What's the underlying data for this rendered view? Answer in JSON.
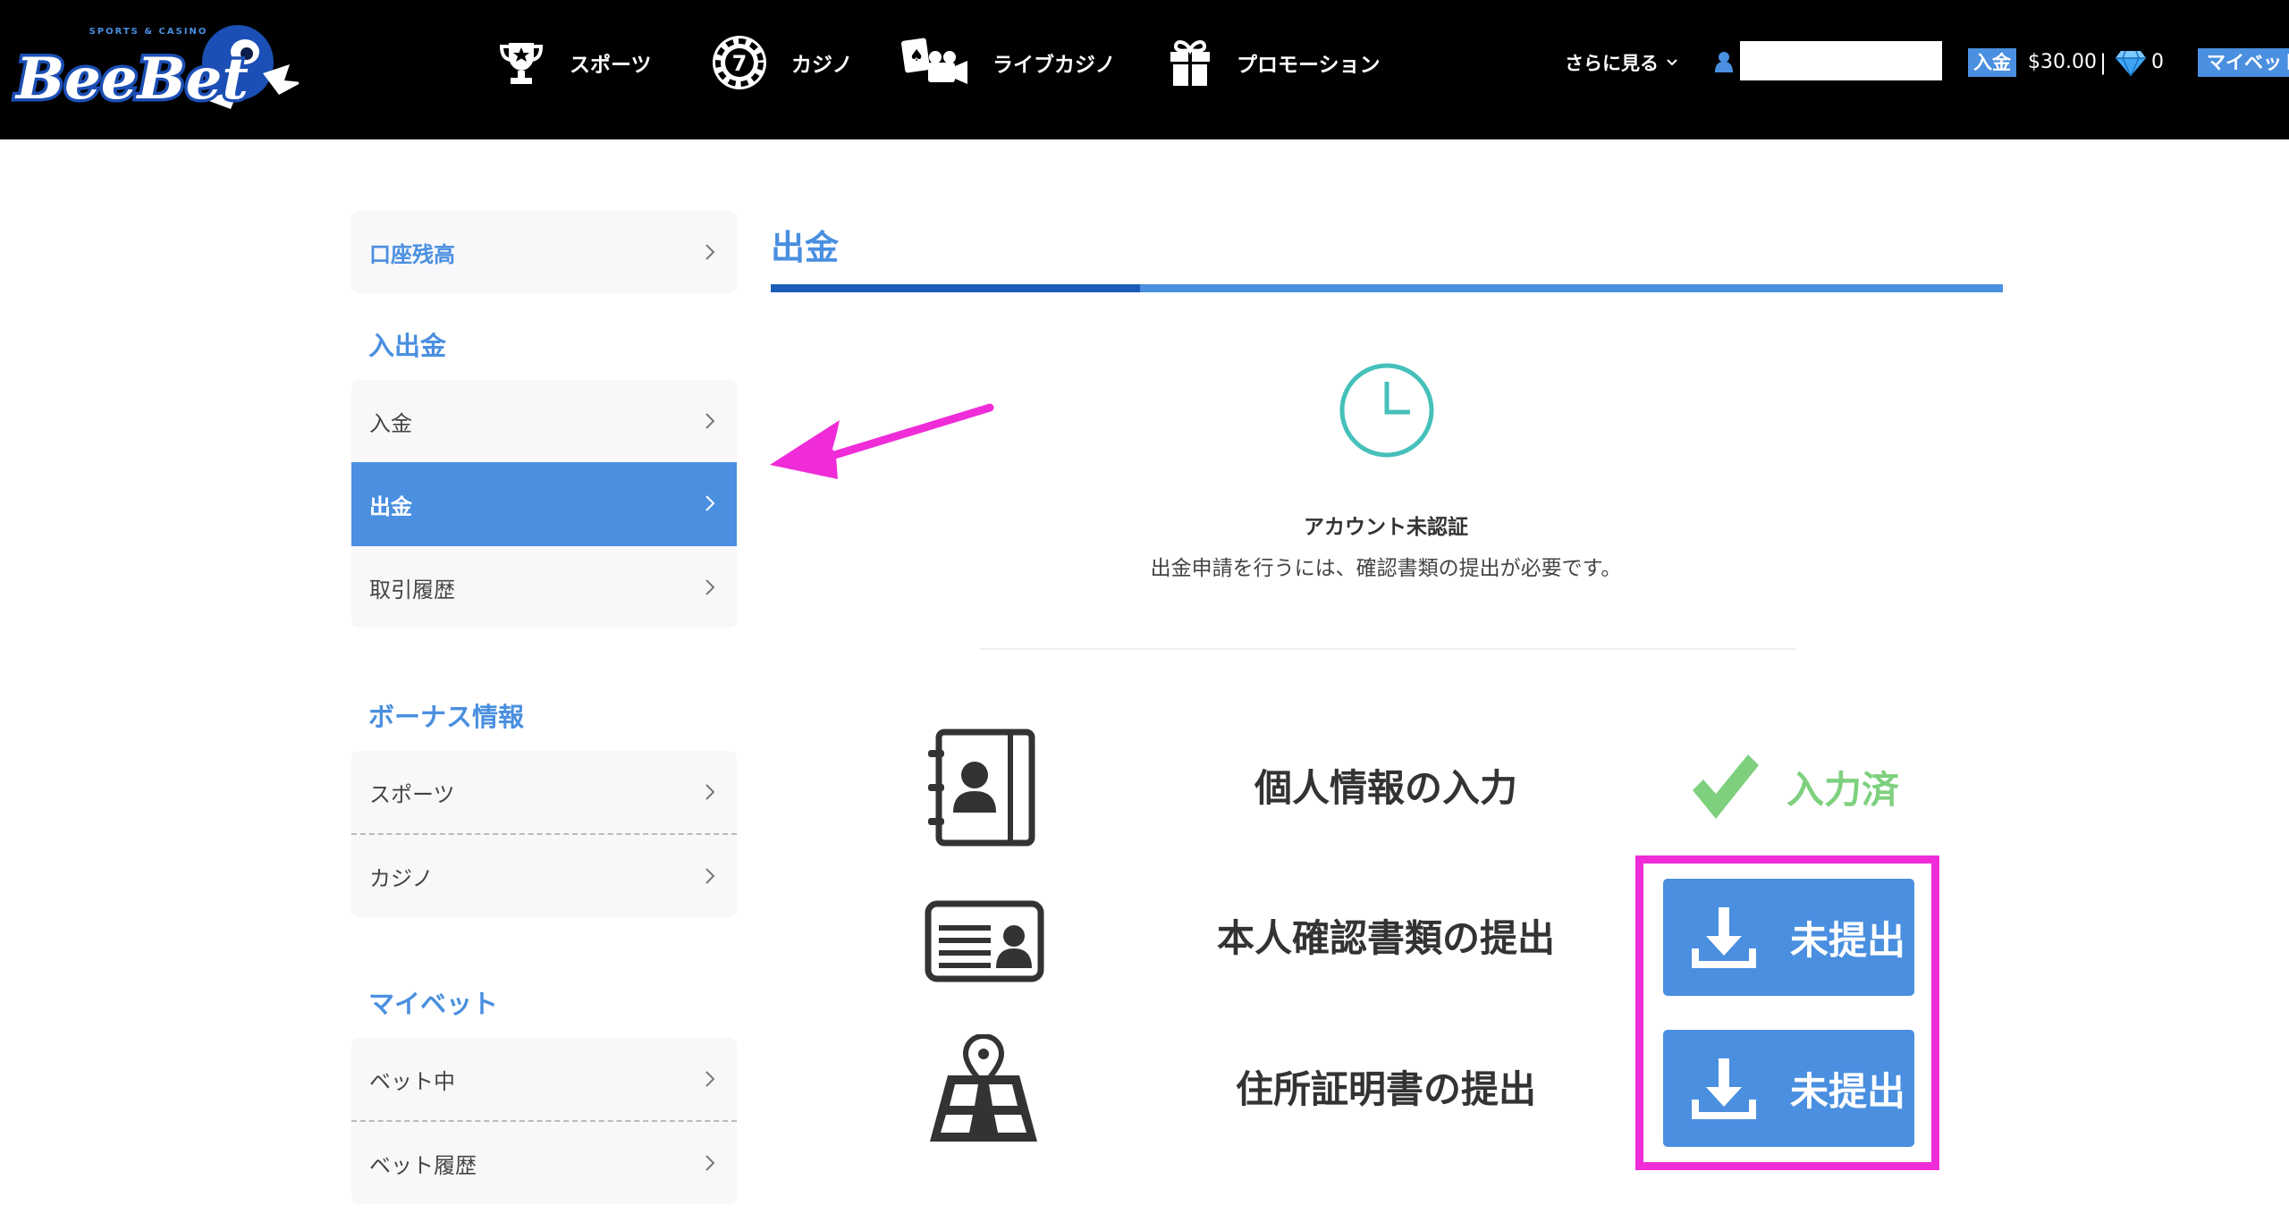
{
  "header": {
    "logo_text": "BeeBet",
    "logo_tagline": "SPORTS & CASINO",
    "nav": [
      {
        "label": "スポーツ",
        "icon": "trophy-icon"
      },
      {
        "label": "カジノ",
        "icon": "casino-chip-icon"
      },
      {
        "label": "ライブカジノ",
        "icon": "live-casino-icon"
      },
      {
        "label": "プロモーション",
        "icon": "gift-icon"
      }
    ],
    "more_label": "さらに見る",
    "user_field_value": "",
    "deposit_label": "入金",
    "balance": "$30.00",
    "separator": "|",
    "diamond_count": "0",
    "mybet_label": "マイベット"
  },
  "sidebar": {
    "balance_item": "口座残高",
    "section_cash": "入出金",
    "deposit": "入金",
    "withdraw": "出金",
    "history": "取引履歴",
    "section_bonus": "ボーナス情報",
    "bonus_sports": "スポーツ",
    "bonus_casino": "カジノ",
    "section_mybet": "マイベット",
    "open_bets": "ベット中",
    "bet_history": "ベット履歴"
  },
  "main": {
    "title": "出金",
    "status_title": "アカウント未認証",
    "status_desc": "出金申請を行うには、確認書類の提出が必要です。",
    "steps": [
      {
        "label": "個人情報の入力",
        "status": "入力済",
        "icon": "contact-book-icon"
      },
      {
        "label": "本人確認書類の提出",
        "status": "未提出",
        "icon": "id-card-icon"
      },
      {
        "label": "住所証明書の提出",
        "status": "未提出",
        "icon": "map-pin-icon"
      }
    ]
  },
  "colors": {
    "accent": "#4a8fe0",
    "accent_dark": "#1a5cb8",
    "success": "#7ed07e",
    "annotation": "#f02cd8",
    "header_bg": "#000000"
  }
}
